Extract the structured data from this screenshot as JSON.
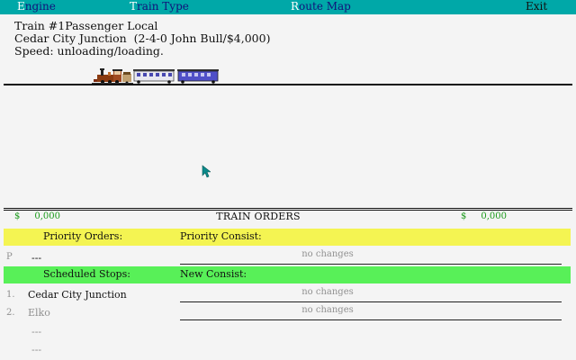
{
  "menu": {
    "engine": {
      "hot": "E",
      "rest": "ngine"
    },
    "train_type": {
      "hot": "T",
      "rest": "rain Type"
    },
    "route_map": {
      "hot": "R",
      "rest": "oute Map"
    },
    "exit": "Exit"
  },
  "train": {
    "line1": "Train #1Passenger Local",
    "line2": "Cedar City Junction  (2-4-0 John Bull/$4,000)",
    "line3": "Speed: unloading/loading."
  },
  "orders": {
    "title": "TRAIN ORDERS",
    "left_money": {
      "symbol": "$",
      "value": "0,000"
    },
    "right_money": {
      "symbol": "$",
      "value": "0,000"
    },
    "priority_orders_label": "Priority Orders:",
    "priority_consist_label": "Priority Consist:",
    "priority_row": {
      "marker": "P",
      "value": "---",
      "consist": "no changes"
    },
    "scheduled_stops_label": "Scheduled Stops:",
    "new_consist_label": "New Consist:",
    "stops": [
      {
        "num": "1.",
        "name": "Cedar City Junction",
        "consist": "no changes"
      },
      {
        "num": "2.",
        "name": "Elko",
        "consist": "no changes"
      },
      {
        "num": "",
        "name": "---"
      },
      {
        "num": "",
        "name": "---"
      }
    ]
  },
  "colors": {
    "menubar": "#00a8a8",
    "menu_text": "#12127a",
    "priority_band": "#f4f452",
    "schedule_band": "#58f058",
    "money_green": "#1a9a1a",
    "background": "#f4f4f4"
  },
  "icons": [
    "locomotive-icon",
    "passenger-car-icon",
    "mouse-cursor-icon"
  ]
}
